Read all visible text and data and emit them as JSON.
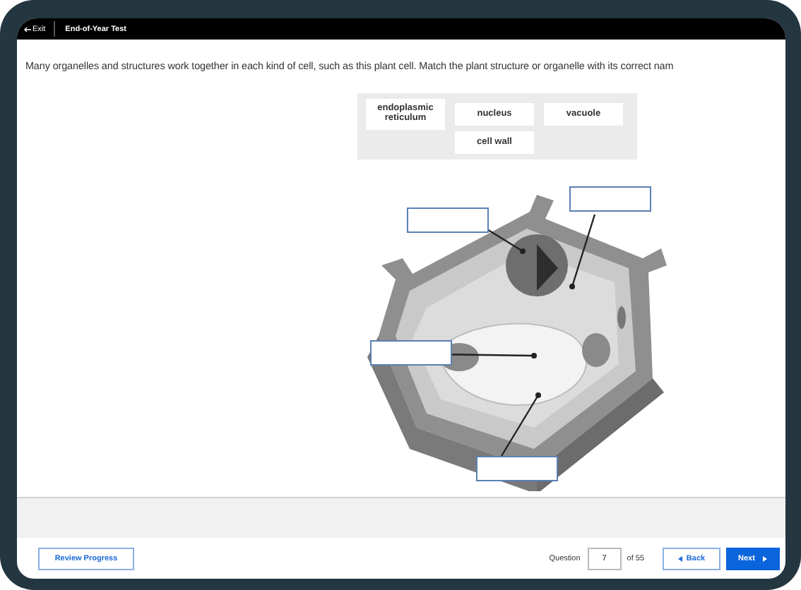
{
  "top_bar": {
    "exit": "Exit",
    "title": "End-of-Year Test"
  },
  "instruction": "Many organelles and structures work together in each kind of cell, such as this plant cell. Match the plant structure or organelle with its correct nam",
  "word_bank": [
    {
      "text": "endoplasmic reticulum"
    },
    {
      "text": "nucleus"
    },
    {
      "text": "vacuole"
    },
    {
      "text": "cell wall"
    }
  ],
  "footer": {
    "review_button": "Review Progress",
    "question_label": "Question",
    "question_value": "7",
    "of_total": "of 55",
    "back_button": "Back",
    "next_button": "Next"
  }
}
